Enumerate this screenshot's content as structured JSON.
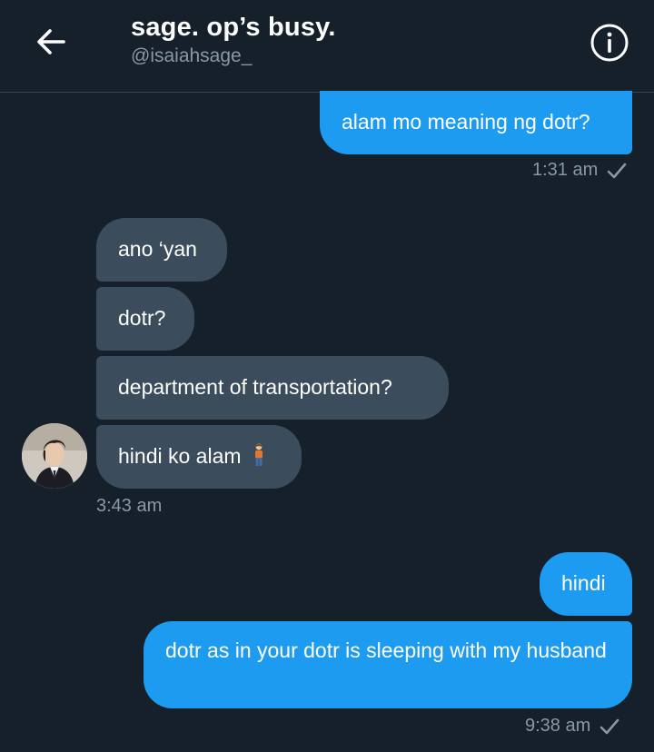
{
  "header": {
    "title": "sage. op’s busy.",
    "handle": "@isaiahsage_",
    "back_icon": "arrow-left-icon",
    "info_icon": "info-circle-icon"
  },
  "messages": [
    {
      "text": "alam mo meaning ng dotr?"
    },
    {
      "text": "ano ‘yan"
    },
    {
      "text": "dotr?"
    },
    {
      "text": "department of transportation?"
    },
    {
      "text": "hindi ko alam"
    },
    {
      "text": "hindi"
    },
    {
      "text": "dotr as in your dotr is sleeping with my husband"
    }
  ],
  "timestamps": {
    "t1": "1:31 am",
    "t2": "3:43 am",
    "t3": "9:38 am"
  },
  "colors": {
    "background": "#15202b",
    "sent_bubble": "#1d9bf0",
    "received_bubble": "#3b4c5c",
    "muted_text": "#8899a6"
  },
  "icons": {
    "read_receipt": "checkmark-icon",
    "emoji": "person-standing-emoji"
  }
}
